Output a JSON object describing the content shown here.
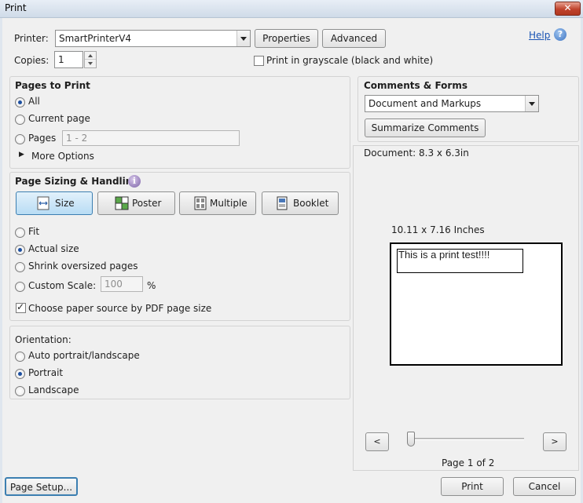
{
  "window": {
    "title": "Print",
    "close_glyph": "✕"
  },
  "header": {
    "printer_label": "Printer:",
    "printer_value": "SmartPrinterV4",
    "properties_label": "Properties",
    "advanced_label": "Advanced",
    "help_label": "Help",
    "copies_label": "Copies:",
    "copies_value": "1",
    "grayscale_label": "Print in grayscale (black and white)",
    "grayscale_checked": false
  },
  "pages_to_print": {
    "title": "Pages to Print",
    "all_label": "All",
    "current_label": "Current page",
    "pages_label": "Pages",
    "pages_placeholder": "1 - 2",
    "more_options_label": "More Options",
    "selected": "All"
  },
  "sizing": {
    "title": "Page Sizing & Handling",
    "info_glyph": "i",
    "modes": [
      "Size",
      "Poster",
      "Multiple",
      "Booklet"
    ],
    "active_mode": "Size",
    "fit_label": "Fit",
    "actual_label": "Actual size",
    "shrink_label": "Shrink oversized pages",
    "custom_label": "Custom Scale:",
    "custom_value": "100",
    "percent_label": "%",
    "paper_source_label": "Choose paper source by PDF page size",
    "paper_source_checked": true,
    "selected": "Actual size"
  },
  "orientation": {
    "title": "Orientation:",
    "auto_label": "Auto portrait/landscape",
    "portrait_label": "Portrait",
    "landscape_label": "Landscape",
    "selected": "Portrait"
  },
  "comments": {
    "title": "Comments & Forms",
    "value": "Document and Markups",
    "summarize_label": "Summarize Comments"
  },
  "preview": {
    "document_size": "Document: 8.3 x 6.3in",
    "paper_size": "10.11 x 7.16 Inches",
    "content_text": "This is a print test!!!!",
    "prev_glyph": "<",
    "next_glyph": ">",
    "page_indicator": "Page 1 of 2",
    "zoom_fraction": 0.0
  },
  "footer": {
    "page_setup_label": "Page Setup...",
    "print_label": "Print",
    "cancel_label": "Cancel"
  },
  "colors": {
    "accent": "#3c7fb1",
    "link": "#1a54b4",
    "close": "#c0432c"
  }
}
